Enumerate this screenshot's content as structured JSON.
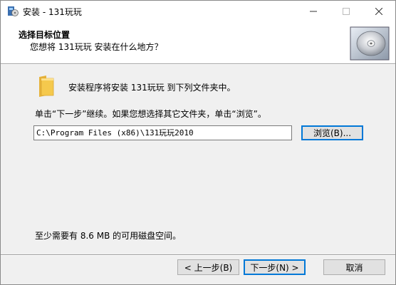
{
  "window": {
    "title": "安装 - 131玩玩"
  },
  "header": {
    "title": "选择目标位置",
    "subtitle": "您想将 131玩玩 安装在什么地方？"
  },
  "body": {
    "intro": "安装程序将安装 131玩玩 到下列文件夹中。",
    "instruction": "单击“下一步”继续。如果您想选择其它文件夹，单击“浏览”。",
    "path_value": "C:\\Program Files (x86)\\131玩玩2010",
    "browse_label": "浏览(B)...",
    "space_required": "至少需要有 8.6 MB 的可用磁盘空间。"
  },
  "footer": {
    "back_label": "< 上一步(B)",
    "next_label": "下一步(N) >",
    "cancel_label": "取消"
  },
  "colors": {
    "accent": "#0078d7",
    "folder": "#f5c94d"
  },
  "icons": [
    "app-icon",
    "minimize-icon",
    "maximize-icon",
    "close-icon",
    "cd-icon",
    "folder-icon"
  ]
}
